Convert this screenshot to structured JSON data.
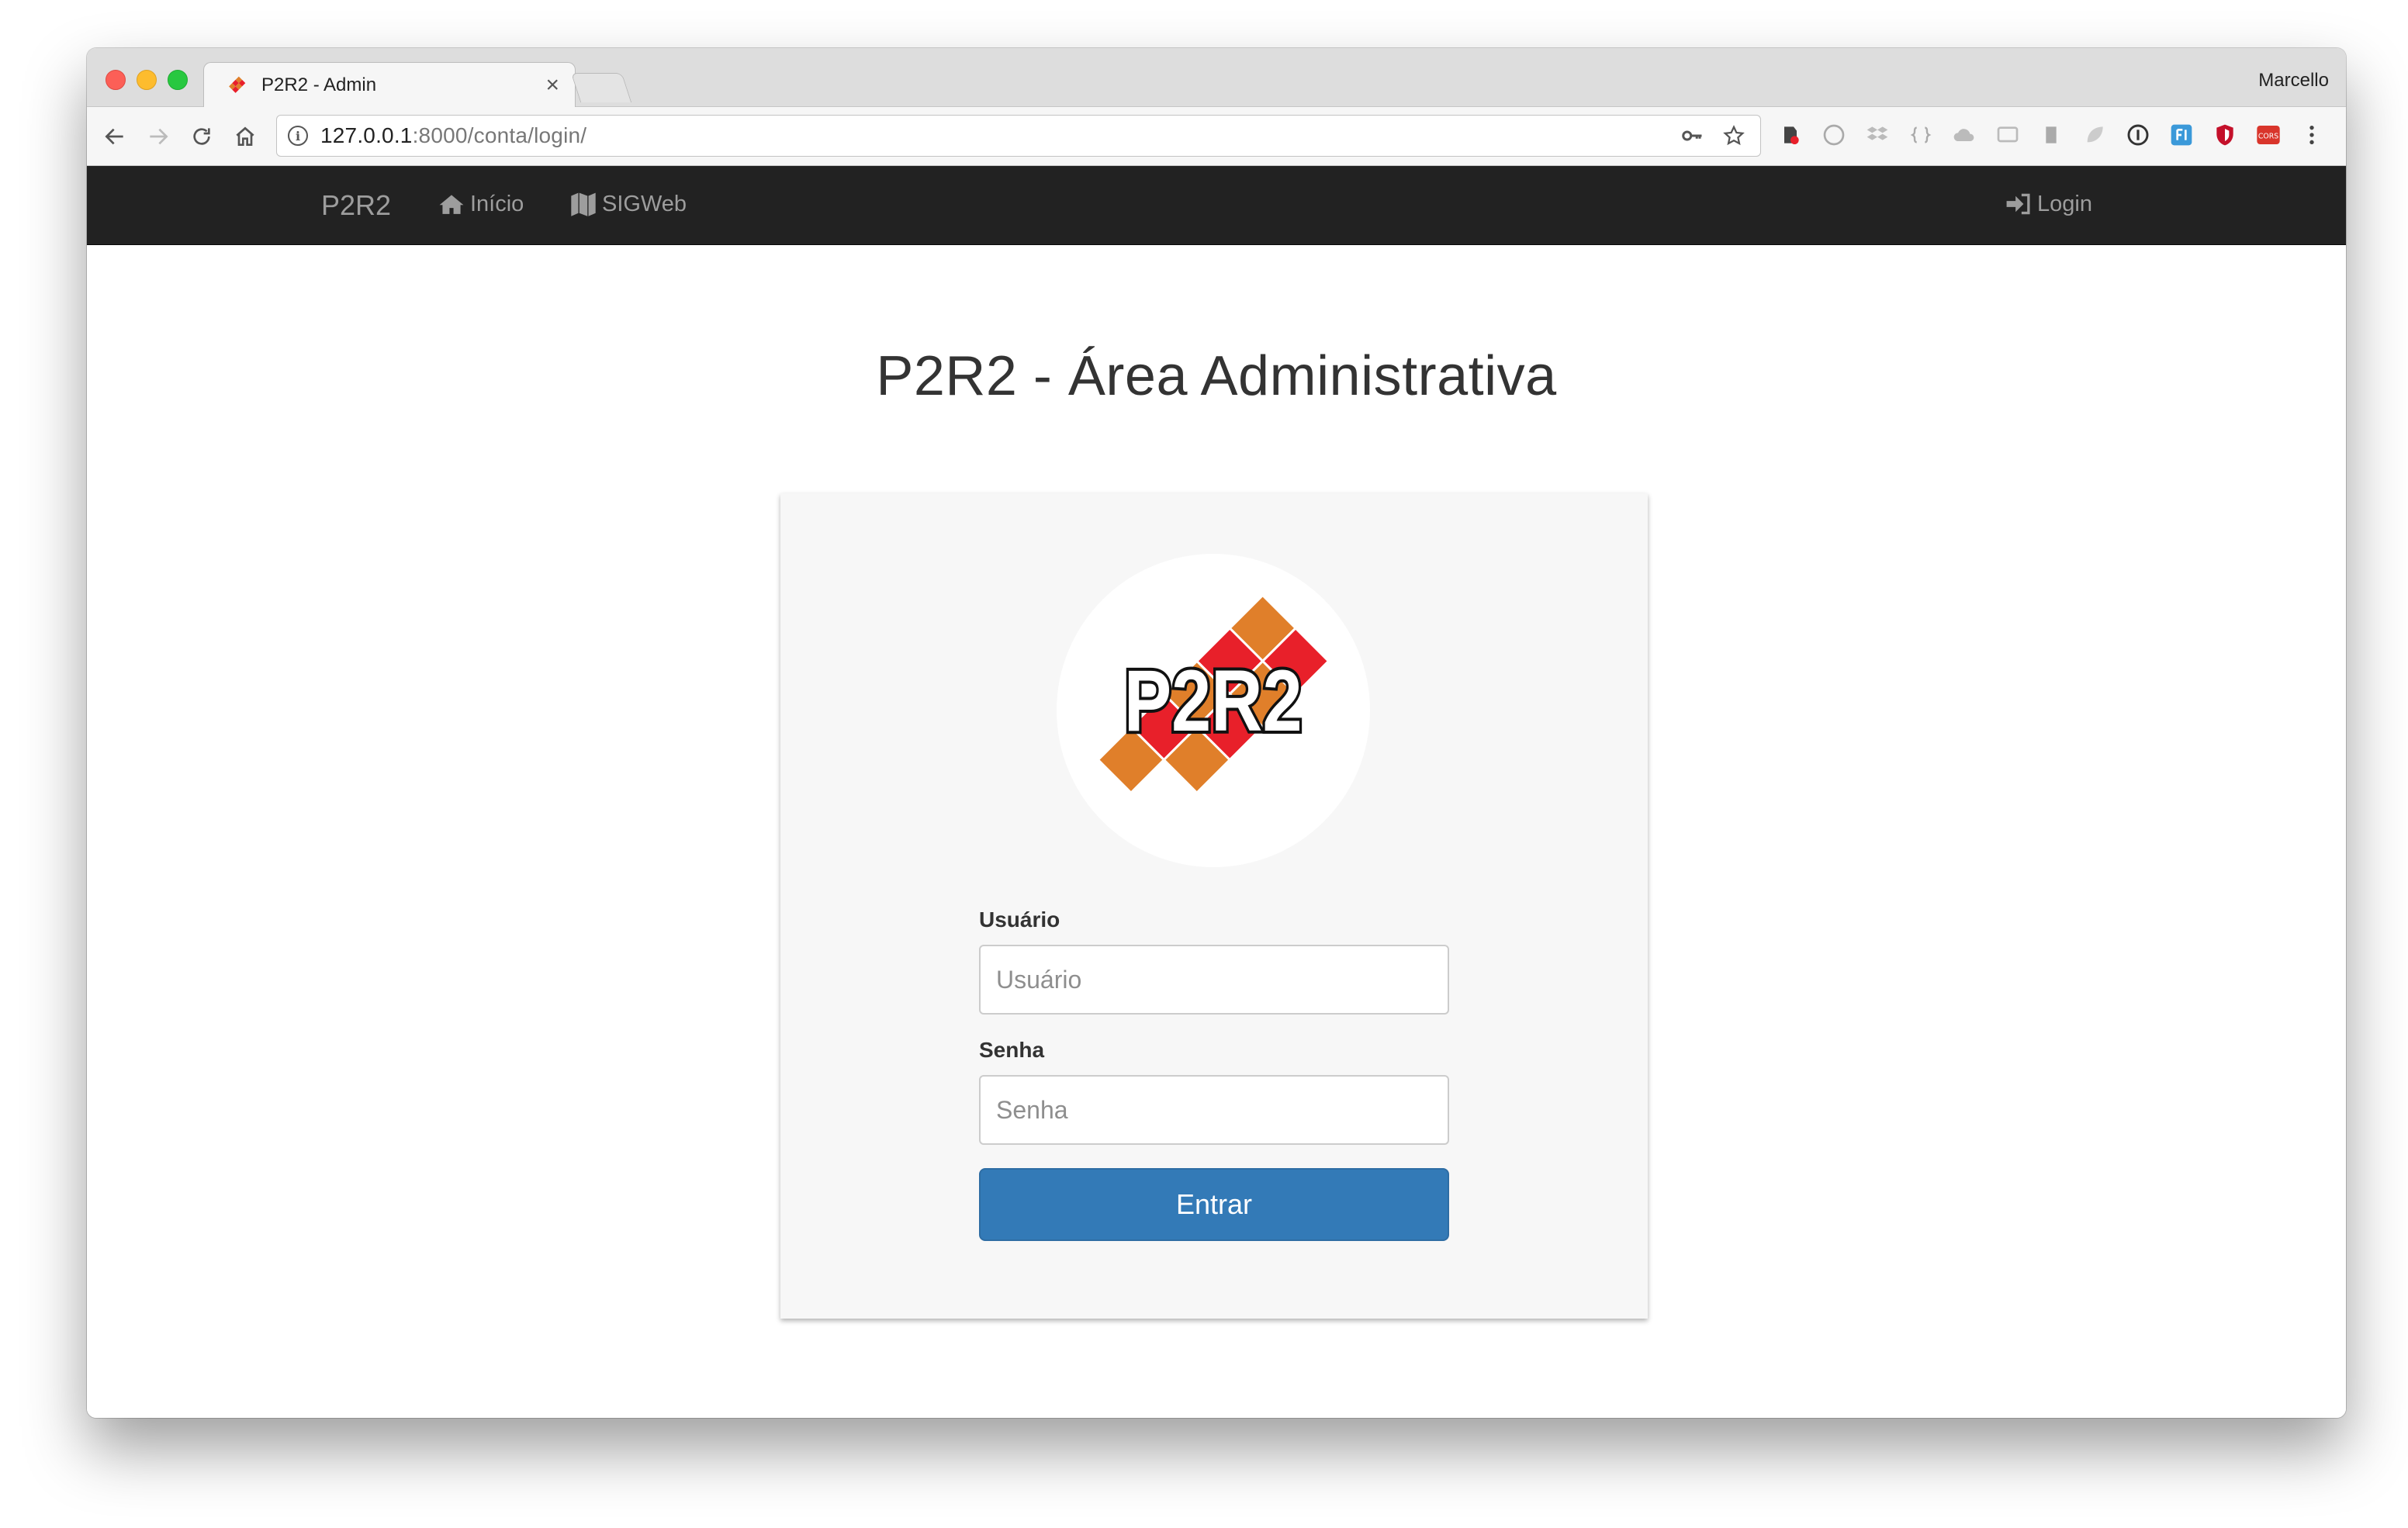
{
  "browser": {
    "tab_title": "P2R2 - Admin",
    "tab_close": "×",
    "profile_name": "Marcello",
    "url_host": "127.0.0.1",
    "url_rest": ":8000/conta/login/"
  },
  "navbar": {
    "brand": "P2R2",
    "links": [
      {
        "label": "Início",
        "icon": "home-icon"
      },
      {
        "label": "SIGWeb",
        "icon": "map-icon"
      }
    ],
    "login": {
      "label": "Login",
      "icon": "sign-in-icon"
    }
  },
  "page": {
    "title": "P2R2 - Área Administrativa"
  },
  "logo": {
    "text": "P2R2",
    "colors": {
      "red": "#e8202a",
      "orange": "#e07f2a"
    }
  },
  "form": {
    "username": {
      "label": "Usuário",
      "placeholder": "Usuário",
      "value": ""
    },
    "password": {
      "label": "Senha",
      "placeholder": "Senha",
      "value": ""
    },
    "submit_label": "Entrar"
  },
  "colors": {
    "navbar_bg": "#222222",
    "primary_button": "#337ab7"
  }
}
